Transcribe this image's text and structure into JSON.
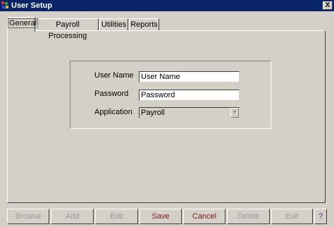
{
  "window": {
    "title": "User Setup",
    "close_label": "X"
  },
  "tabs": [
    {
      "label": "General"
    },
    {
      "label": "Payroll Processing"
    },
    {
      "label": "Utilities"
    },
    {
      "label": "Reports"
    }
  ],
  "form": {
    "user_name": {
      "label": "User Name",
      "value": "User Name"
    },
    "password": {
      "label": "Password",
      "value": "Password"
    },
    "application": {
      "label": "Application",
      "value": "Payroll"
    }
  },
  "buttons": [
    {
      "label": "Browse",
      "state": "disabled"
    },
    {
      "label": "Add",
      "state": "disabled"
    },
    {
      "label": "Edit",
      "state": "disabled"
    },
    {
      "label": "Save",
      "state": "enabled"
    },
    {
      "label": "Cancel",
      "state": "enabled"
    },
    {
      "label": "Delete",
      "state": "disabled"
    },
    {
      "label": "Exit",
      "state": "disabled"
    },
    {
      "label": "?",
      "state": "enabled"
    }
  ],
  "colors": {
    "title_bar": "#0a246a",
    "face": "#d4d0c8",
    "button_text": "#7a1a1a"
  }
}
